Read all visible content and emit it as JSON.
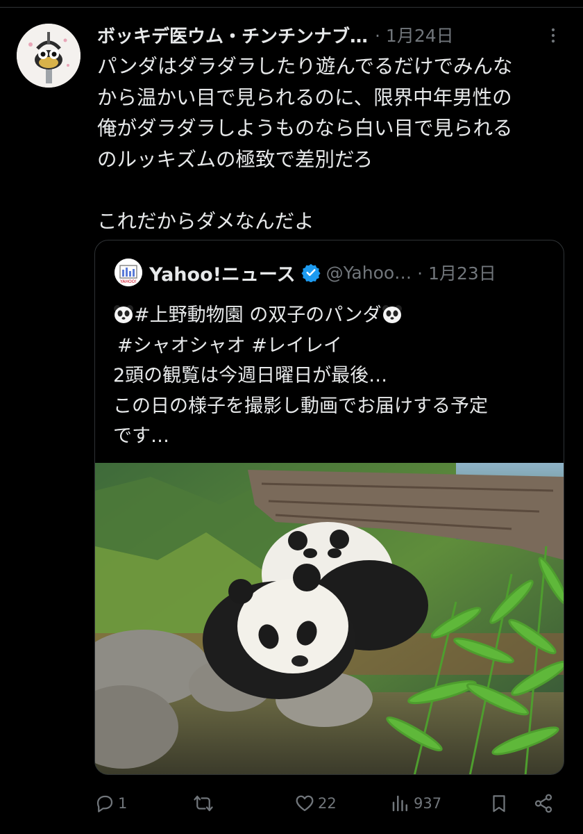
{
  "tweet": {
    "display_name": "ボッキデ医ウム・チンチンナブ…",
    "meta": "· 1月24日",
    "text_lines": [
      "パンダはダラダラしたり遊んでるだけでみんな",
      "から温かい目で見られるのに、限界中年男性の",
      "俺がダラダラしようものなら白い目で見られる",
      "のルッキズムの極致で差別だろ",
      "",
      "これだからダメなんだよ"
    ]
  },
  "quote": {
    "name": "Yahoo!ニュース",
    "handle": "@Yahoo…",
    "meta": "· 1月23日",
    "avatar_text": "YAHOO!",
    "line1": "#上野動物園 の双子のパンダ",
    "line2": "#シャオシャオ #レイレイ",
    "line3": "2頭の観覧は今週日曜日が最後…",
    "line4": "この日の様子を撮影し動画でお届けする予定",
    "line5": "です…"
  },
  "actions": {
    "reply_count": "1",
    "retweet_count": "",
    "like_count": "22",
    "views_count": "937"
  },
  "colors": {
    "background": "#000000",
    "text": "#e7e9ea",
    "muted": "#71767b",
    "border": "#2f3336",
    "verified": "#1d9bf0"
  }
}
